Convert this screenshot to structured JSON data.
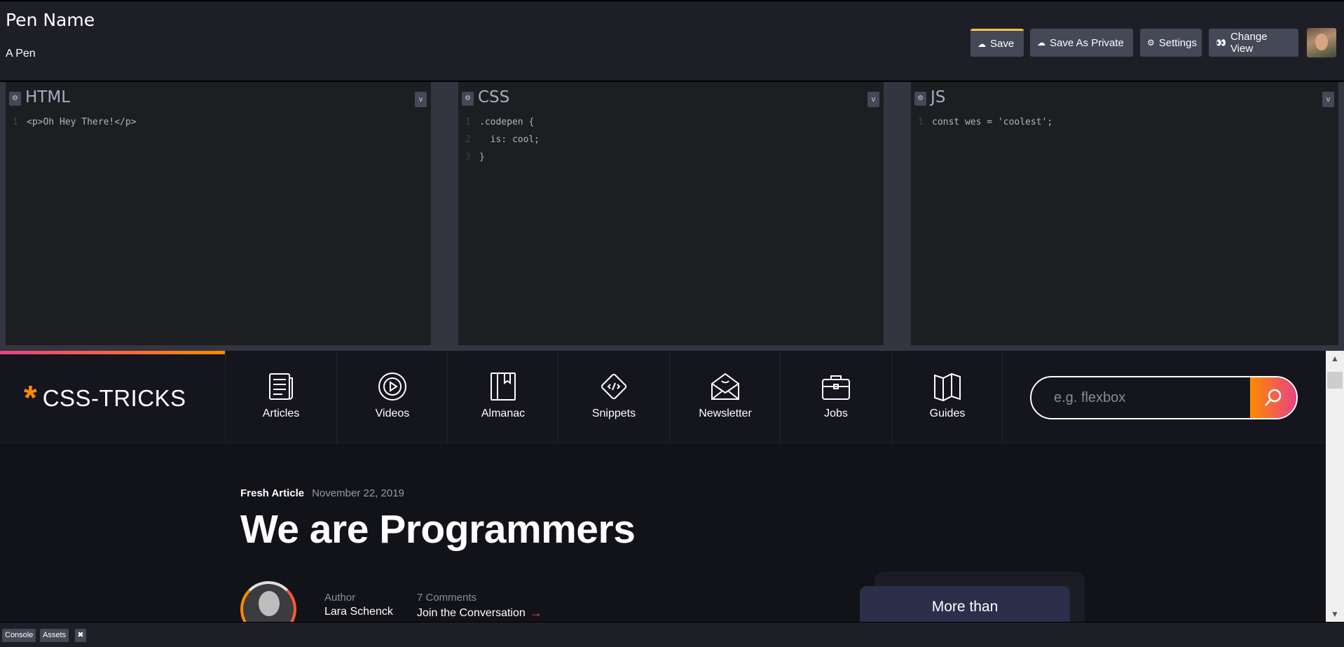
{
  "header": {
    "pen_name": "Pen Name",
    "subtitle": "A Pen",
    "buttons": {
      "save": "Save",
      "save_private": "Save As Private",
      "settings": "Settings",
      "change_view": "Change View"
    },
    "accent_color": "#f7c24b"
  },
  "editors": {
    "html": {
      "title": "HTML",
      "lines": [
        {
          "num": "1",
          "code": "<p>Oh Hey There!</p>"
        }
      ]
    },
    "css": {
      "title": "CSS",
      "lines": [
        {
          "num": "1",
          "code": ".codepen {"
        },
        {
          "num": "2",
          "code": "  is: cool;"
        },
        {
          "num": "3",
          "code": "}"
        }
      ]
    },
    "js": {
      "title": "JS",
      "lines": [
        {
          "num": "1",
          "code": "const wes = 'coolest';"
        }
      ]
    }
  },
  "preview": {
    "logo_text": "CSS-TRICKS",
    "logo_star": "*",
    "nav": [
      {
        "label": "Articles",
        "icon": "articles-icon"
      },
      {
        "label": "Videos",
        "icon": "videos-icon"
      },
      {
        "label": "Almanac",
        "icon": "almanac-icon"
      },
      {
        "label": "Snippets",
        "icon": "snippets-icon"
      },
      {
        "label": "Newsletter",
        "icon": "newsletter-icon"
      },
      {
        "label": "Jobs",
        "icon": "jobs-icon"
      },
      {
        "label": "Guides",
        "icon": "guides-icon"
      }
    ],
    "search_placeholder": "e.g. flexbox",
    "article": {
      "kicker": "Fresh Article",
      "date": "November 22, 2019",
      "title": "We are Programmers",
      "author_label": "Author",
      "author_name": "Lara Schenck",
      "comments_label": "7 Comments",
      "comments_link": "Join the Conversation"
    },
    "promo_text": "More than",
    "brand_gradient": [
      "#ff8a00",
      "#e74285"
    ]
  },
  "bottom": {
    "console": "Console",
    "assets": "Assets",
    "close": "✖"
  }
}
